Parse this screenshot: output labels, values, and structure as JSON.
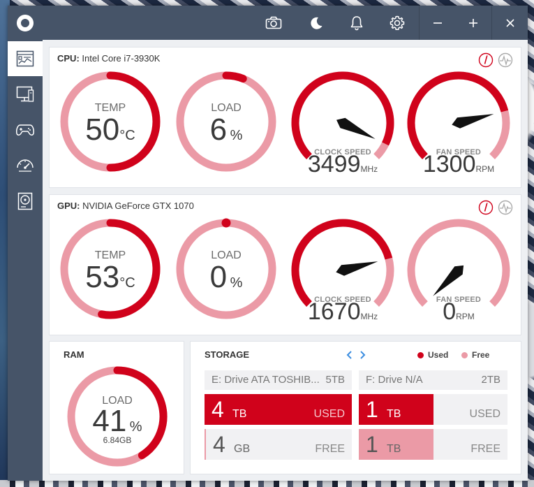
{
  "colors": {
    "accent": "#d0021b",
    "light": "#eb9aa6",
    "titlebar": "#465468",
    "panel": "#ffffff"
  },
  "titlebar": {
    "icons": [
      "logo-icon",
      "camera-icon",
      "moon-icon",
      "bell-icon",
      "gear-icon",
      "minimize-icon",
      "maximize-icon",
      "close-icon"
    ]
  },
  "sidebar": {
    "items": [
      {
        "icon": "dashboard-icon",
        "active": true
      },
      {
        "icon": "monitor-icon",
        "active": false
      },
      {
        "icon": "gamepad-icon",
        "active": false
      },
      {
        "icon": "speedometer-icon",
        "active": false
      },
      {
        "icon": "disk-icon",
        "active": false
      }
    ]
  },
  "cpu": {
    "prefix": "CPU:",
    "name": "Intel Core i7-3930K",
    "temp": {
      "label": "TEMP",
      "value": "50",
      "unit": "°C",
      "percent": 0.5
    },
    "load": {
      "label": "LOAD",
      "value": "6",
      "unit": "%",
      "percent": 0.06
    },
    "clock": {
      "label": "CLOCK SPEED",
      "value": "3499",
      "unit": "MHz",
      "percent": 0.93
    },
    "fan": {
      "label": "FAN SPEED",
      "value": "1300",
      "unit": "RPM",
      "percent": 0.78
    }
  },
  "gpu": {
    "prefix": "GPU:",
    "name": "NVIDIA GeForce GTX 1070",
    "temp": {
      "label": "TEMP",
      "value": "53",
      "unit": "°C",
      "percent": 0.53
    },
    "load": {
      "label": "LOAD",
      "value": "0",
      "unit": "%",
      "percent": 0.0
    },
    "clock": {
      "label": "CLOCK SPEED",
      "value": "1670",
      "unit": "MHz",
      "percent": 0.78
    },
    "fan": {
      "label": "FAN SPEED",
      "value": "0",
      "unit": "RPM",
      "percent": 0.0
    }
  },
  "ram": {
    "title": "RAM",
    "label": "LOAD",
    "value": "41",
    "unit": "%",
    "sub": "6.84GB",
    "percent": 0.41
  },
  "storage": {
    "title": "STORAGE",
    "legend_used": "Used",
    "legend_free": "Free",
    "drives": [
      {
        "name": "E: Drive ATA TOSHIB...",
        "size": "5TB",
        "used_value": "4",
        "used_unit": "TB",
        "used_label": "USED",
        "used_fraction": 1.0,
        "free_value": "4",
        "free_unit": "GB",
        "free_label": "FREE",
        "free_fraction": 0.0
      },
      {
        "name": "F: Drive N/A",
        "size": "2TB",
        "used_value": "1",
        "used_unit": "TB",
        "used_label": "USED",
        "used_fraction": 0.5,
        "free_value": "1",
        "free_unit": "TB",
        "free_label": "FREE",
        "free_fraction": 0.5
      }
    ]
  }
}
